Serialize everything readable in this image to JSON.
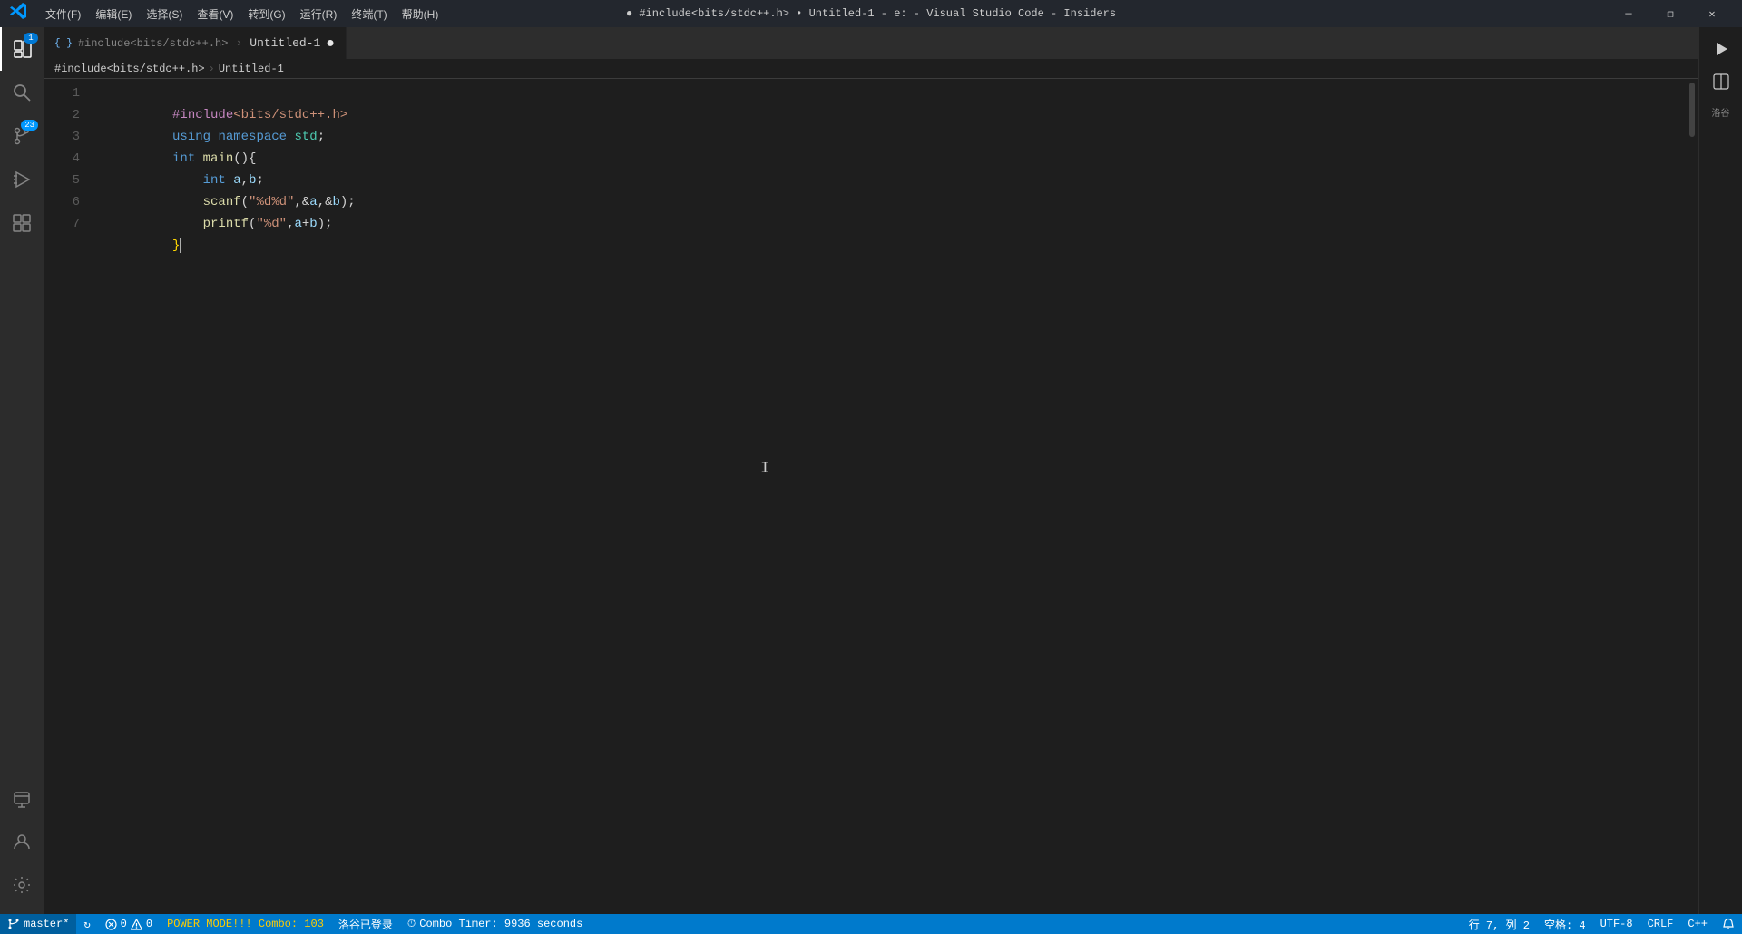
{
  "titlebar": {
    "logo": "✕",
    "menu": [
      "文件(F)",
      "编辑(E)",
      "选择(S)",
      "查看(V)",
      "转到(G)",
      "运行(R)",
      "终端(T)",
      "帮助(H)"
    ],
    "title": "● #include<bits/stdc++.h> • Untitled-1 - e: - Visual Studio Code - Insiders",
    "buttons": [
      "—",
      "❐",
      "✕"
    ]
  },
  "activity_bar": {
    "items": [
      {
        "name": "explorer",
        "icon": "⊞",
        "active": true,
        "badge": "1"
      },
      {
        "name": "search",
        "icon": "🔍"
      },
      {
        "name": "source-control",
        "icon": "⑃",
        "badge": "23"
      },
      {
        "name": "run-debug",
        "icon": "▷"
      },
      {
        "name": "extensions",
        "icon": "⊞2"
      }
    ],
    "bottom": [
      {
        "name": "remote",
        "icon": "⌂"
      },
      {
        "name": "accounts",
        "icon": "👤"
      },
      {
        "name": "settings",
        "icon": "⚙"
      }
    ]
  },
  "tab": {
    "icon": "{ }",
    "path": "#include<bits/stdc++.h>",
    "filename": "Untitled-1",
    "modified": true
  },
  "breadcrumb": {
    "path": "#include<bits/stdc++.h>",
    "sep": ">",
    "file": "Untitled-1"
  },
  "code": {
    "lines": [
      {
        "num": "1",
        "content": "#include<bits/stdc++.h>",
        "type": "include"
      },
      {
        "num": "2",
        "content": "using namespace std;",
        "type": "using"
      },
      {
        "num": "3",
        "content": "int main(){",
        "type": "main"
      },
      {
        "num": "4",
        "content": "    int a,b;",
        "type": "decl"
      },
      {
        "num": "5",
        "content": "    scanf(\"%d%d\",&a,&b);",
        "type": "scanf"
      },
      {
        "num": "6",
        "content": "    printf(\"%d\",a+b);",
        "type": "printf"
      },
      {
        "num": "7",
        "content": "}",
        "type": "close"
      }
    ]
  },
  "statusbar": {
    "branch": "master*",
    "sync_icon": "↻",
    "errors": "0",
    "warnings": "0",
    "power_mode": "POWER MODE!!! Combo: 103",
    "login": "洛谷已登录",
    "timer_icon": "⏱",
    "combo_timer": "Combo Timer: 9936 seconds",
    "position": "行 7, 列 2",
    "spaces": "空格: 4",
    "encoding": "UTF-8",
    "line_ending": "CRLF",
    "language": "C++"
  },
  "right_toolbar": {
    "run_icon": "▶",
    "split_icon": "⊟",
    "more_icon": "···"
  }
}
